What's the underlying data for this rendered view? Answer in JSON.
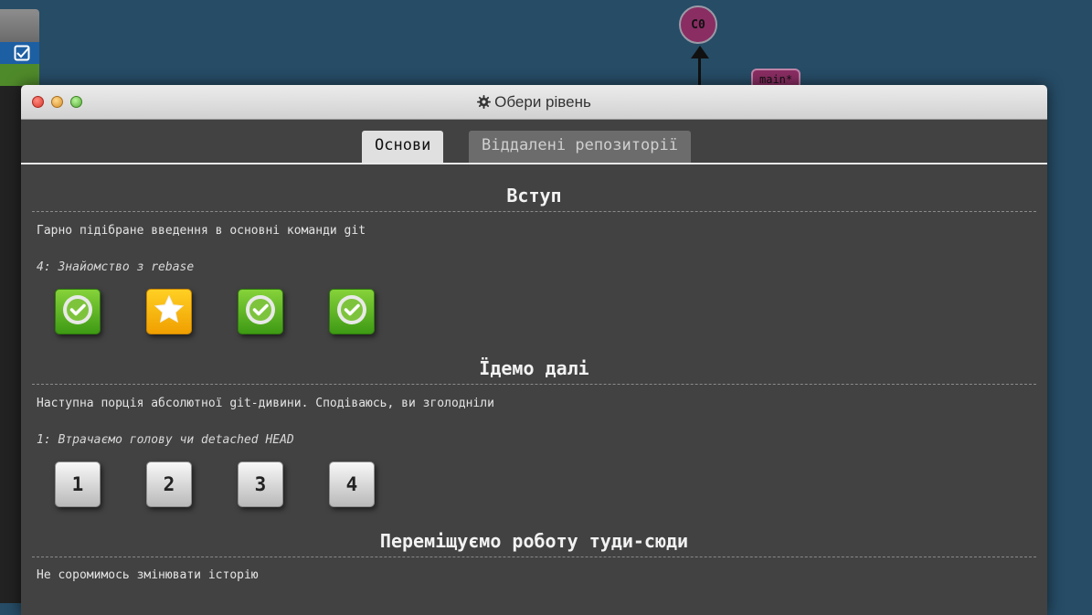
{
  "background": {
    "commit_label": "C0",
    "branch_label": "main*"
  },
  "window": {
    "title": "Обери рівень",
    "tabs": [
      {
        "label": "Основи",
        "active": true
      },
      {
        "label": "Віддалені репозиторії",
        "active": false
      }
    ]
  },
  "sections": [
    {
      "title": "Вступ",
      "description": "Гарно підібране введення в основні команди git",
      "current_level": "4: Знайомство з rebase",
      "levels": [
        {
          "state": "done",
          "icon": "check-icon"
        },
        {
          "state": "current",
          "icon": "star-icon"
        },
        {
          "state": "done",
          "icon": "check-icon"
        },
        {
          "state": "done",
          "icon": "check-icon"
        }
      ]
    },
    {
      "title": "Їдемо далі",
      "description": "Наступна порція абсолютної git-дивини. Сподіваюсь, ви зголодніли",
      "current_level": "1: Втрачаємо голову чи detached HEAD",
      "levels": [
        {
          "state": "todo",
          "label": "1"
        },
        {
          "state": "todo",
          "label": "2"
        },
        {
          "state": "todo",
          "label": "3"
        },
        {
          "state": "todo",
          "label": "4"
        }
      ]
    },
    {
      "title": "Переміщуємо роботу туди-сюди",
      "description": "Не соромимось змінювати історію"
    }
  ],
  "colors": {
    "background": "#264c66",
    "done": "#5cb82a",
    "current": "#f5b100",
    "todo": "#d8d8d8"
  }
}
